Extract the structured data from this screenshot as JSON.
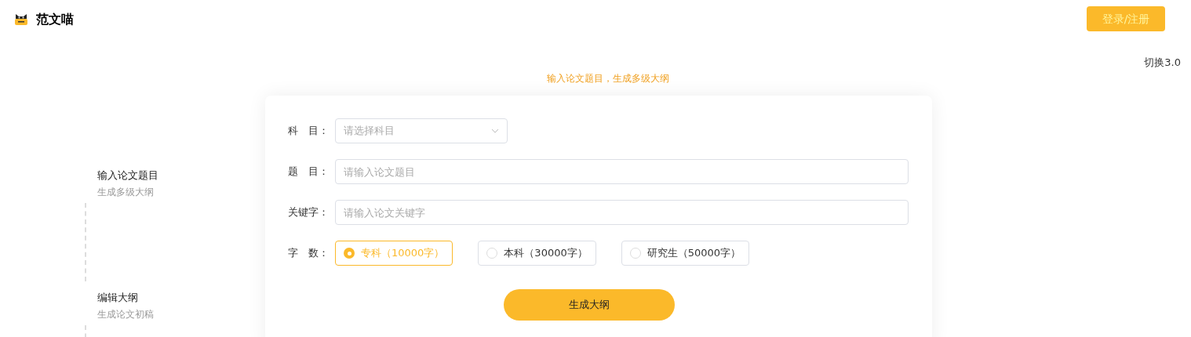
{
  "header": {
    "brand": "范文喵",
    "login_button": "登录/注册"
  },
  "version_switch": "切换3.0",
  "hint": "输入论文题目，生成多级大纲",
  "steps": [
    {
      "title": "输入论文题目",
      "subtitle": "生成多级大纲"
    },
    {
      "title": "编辑大纲",
      "subtitle": "生成论文初稿"
    }
  ],
  "form": {
    "fields": [
      {
        "kind": "select",
        "label": "科　目：",
        "placeholder": "请选择科目"
      },
      {
        "kind": "input",
        "label": "题　目：",
        "placeholder": "请输入论文题目"
      },
      {
        "kind": "input",
        "label": "关键字：",
        "placeholder": "请输入论文关键字"
      }
    ],
    "word_count": {
      "label": "字　数：",
      "options": [
        {
          "label": "专科（10000字）",
          "selected": true
        },
        {
          "label": "本科（30000字）",
          "selected": false
        },
        {
          "label": "研究生（50000字）",
          "selected": false
        }
      ]
    },
    "submit": "生成大纲"
  }
}
